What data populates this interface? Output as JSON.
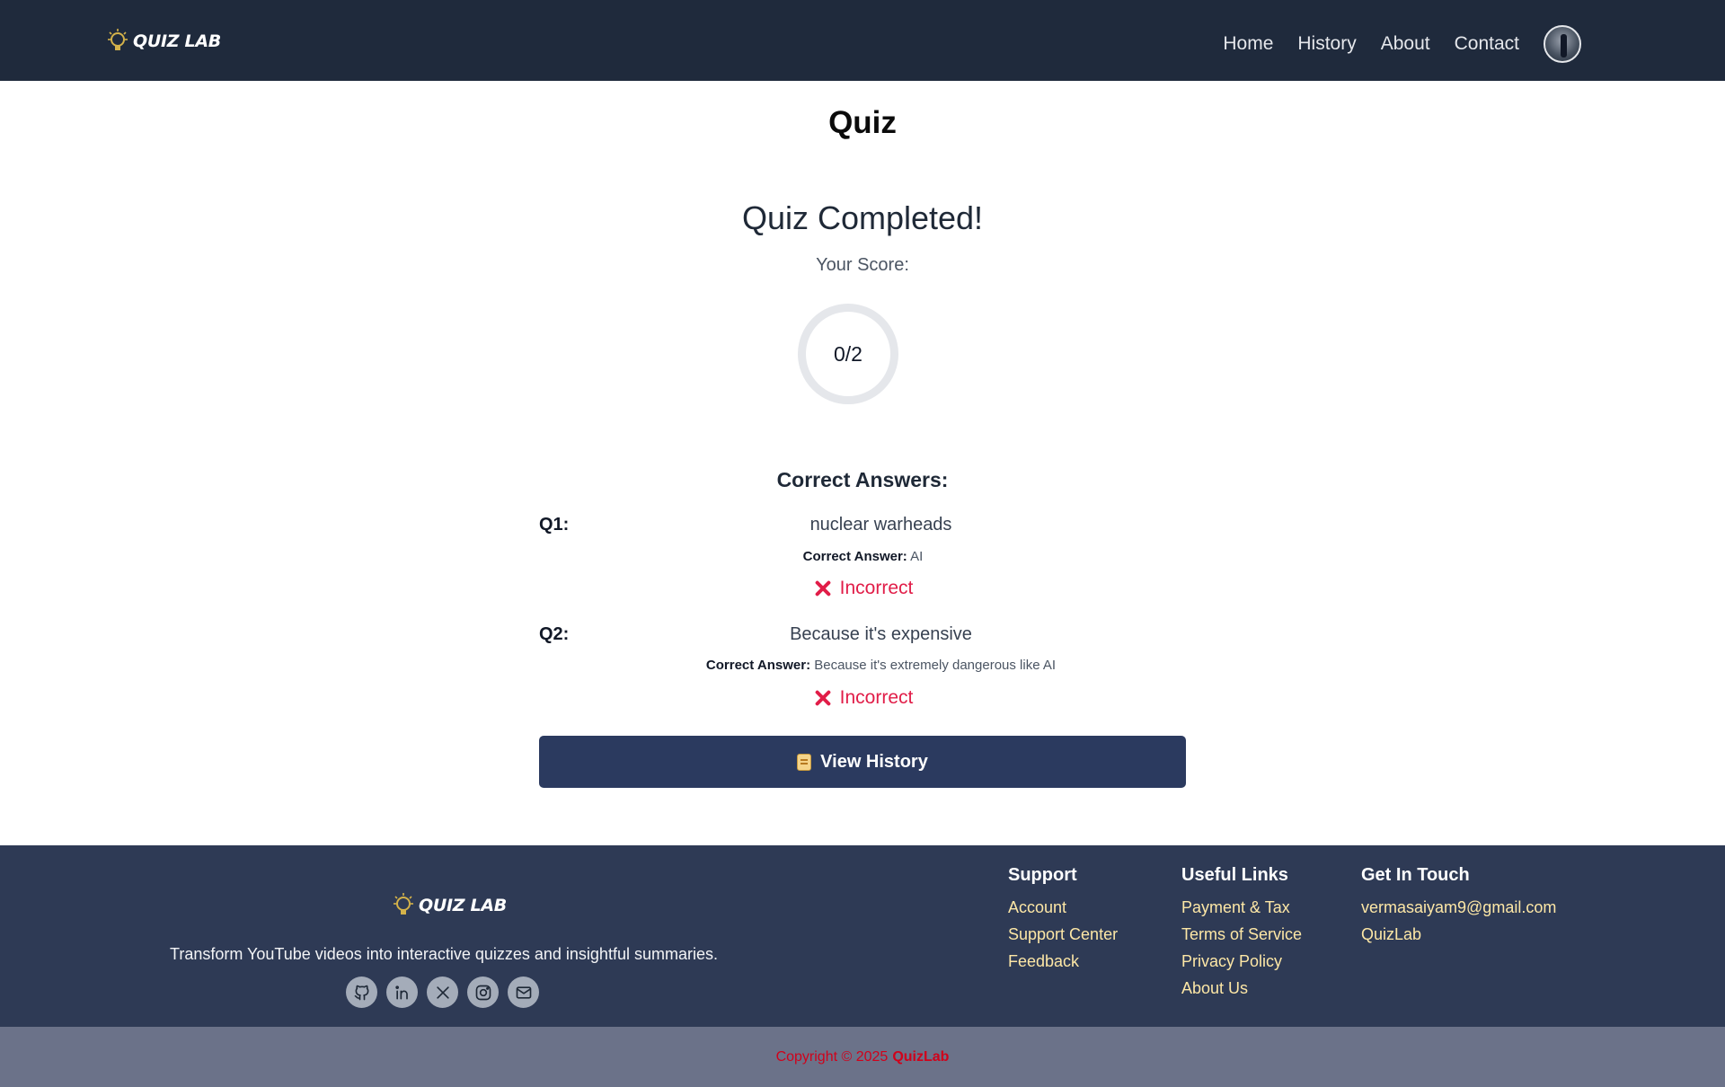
{
  "header": {
    "brand": "QUIZ LAB",
    "nav": [
      "Home",
      "History",
      "About",
      "Contact"
    ]
  },
  "main": {
    "page_title": "Quiz",
    "completed_title": "Quiz Completed!",
    "score_label": "Your Score:",
    "score": "0/2",
    "answers_title": "Correct Answers:",
    "questions": [
      {
        "label": "Q1:",
        "user_answer": "nuclear warheads",
        "correct_label": "Correct Answer:",
        "correct_answer": "AI",
        "status": "Incorrect"
      },
      {
        "label": "Q2:",
        "user_answer": "Because it's expensive",
        "correct_label": "Correct Answer:",
        "correct_answer": "Because it's extremely dangerous like AI",
        "status": "Incorrect"
      }
    ],
    "history_button": "View History"
  },
  "footer": {
    "brand": "QUIZ LAB",
    "tagline": "Transform YouTube videos into interactive quizzes and insightful summaries.",
    "socials": [
      "github-icon",
      "linkedin-icon",
      "x-icon",
      "instagram-icon",
      "mail-icon"
    ],
    "support": {
      "title": "Support",
      "links": [
        "Account",
        "Support Center",
        "Feedback"
      ]
    },
    "useful_links": {
      "title": "Useful Links",
      "links": [
        "Payment & Tax",
        "Terms of Service",
        "Privacy Policy",
        "About Us"
      ]
    },
    "contact": {
      "title": "Get In Touch",
      "links": [
        "vermasaiyam9@gmail.com",
        "QuizLab"
      ]
    },
    "copyright_prefix": "Copyright © 2025",
    "copyright_brand": "QuizLab"
  },
  "colors": {
    "header_bg": "#1f2a3c",
    "footer_bg": "#2e3a55",
    "button_bg": "#2b3a5f",
    "incorrect": "#e11d48",
    "link": "#fde7a6",
    "copyright": "#d0021b"
  }
}
